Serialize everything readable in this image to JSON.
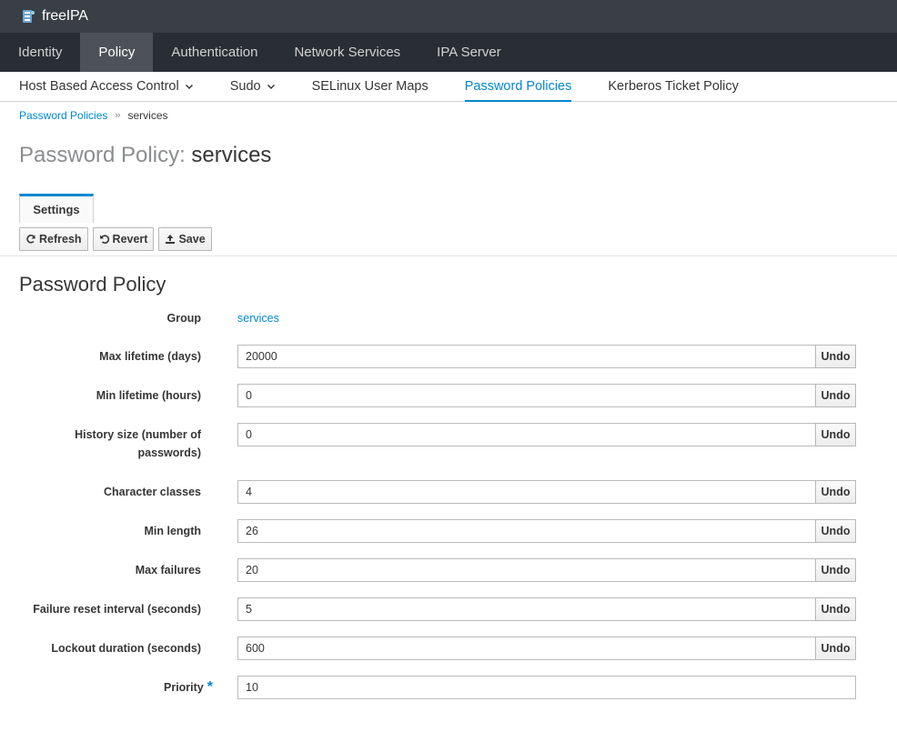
{
  "brand": {
    "name": "freeIPA"
  },
  "primary_nav": [
    {
      "label": "Identity",
      "active": false
    },
    {
      "label": "Policy",
      "active": true
    },
    {
      "label": "Authentication",
      "active": false
    },
    {
      "label": "Network Services",
      "active": false
    },
    {
      "label": "IPA Server",
      "active": false
    }
  ],
  "secondary_nav": [
    {
      "label": "Host Based Access Control",
      "dropdown": true,
      "active": false
    },
    {
      "label": "Sudo",
      "dropdown": true,
      "active": false
    },
    {
      "label": "SELinux User Maps",
      "dropdown": false,
      "active": false
    },
    {
      "label": "Password Policies",
      "dropdown": false,
      "active": true
    },
    {
      "label": "Kerberos Ticket Policy",
      "dropdown": false,
      "active": false
    }
  ],
  "breadcrumb": {
    "parent": "Password Policies",
    "separator": "»",
    "current": "services"
  },
  "title": {
    "prefix": "Password Policy:",
    "name": "services"
  },
  "facet_tab": "Settings",
  "actions": {
    "refresh": "Refresh",
    "revert": "Revert",
    "save": "Save"
  },
  "section_title": "Password Policy",
  "group": {
    "label": "Group",
    "value": "services"
  },
  "fields": [
    {
      "label": "Max lifetime (days)",
      "value": "20000",
      "undo": "Undo"
    },
    {
      "label": "Min lifetime (hours)",
      "value": "0",
      "undo": "Undo"
    },
    {
      "label_line1": "History size (number of",
      "label_line2": "passwords)",
      "value": "0",
      "undo": "Undo"
    },
    {
      "label": "Character classes",
      "value": "4",
      "undo": "Undo"
    },
    {
      "label": "Min length",
      "value": "26",
      "undo": "Undo"
    },
    {
      "label": "Max failures",
      "value": "20",
      "undo": "Undo"
    },
    {
      "label": "Failure reset interval (seconds)",
      "value": "5",
      "undo": "Undo"
    },
    {
      "label": "Lockout duration (seconds)",
      "value": "600",
      "undo": "Undo"
    }
  ],
  "priority": {
    "label": "Priority",
    "required_mark": "*",
    "value": "10"
  },
  "colors": {
    "accent": "#0088ce",
    "brandbar": "#393f44",
    "primary_nav": "#292e34",
    "primary_active": "#4d5258"
  }
}
